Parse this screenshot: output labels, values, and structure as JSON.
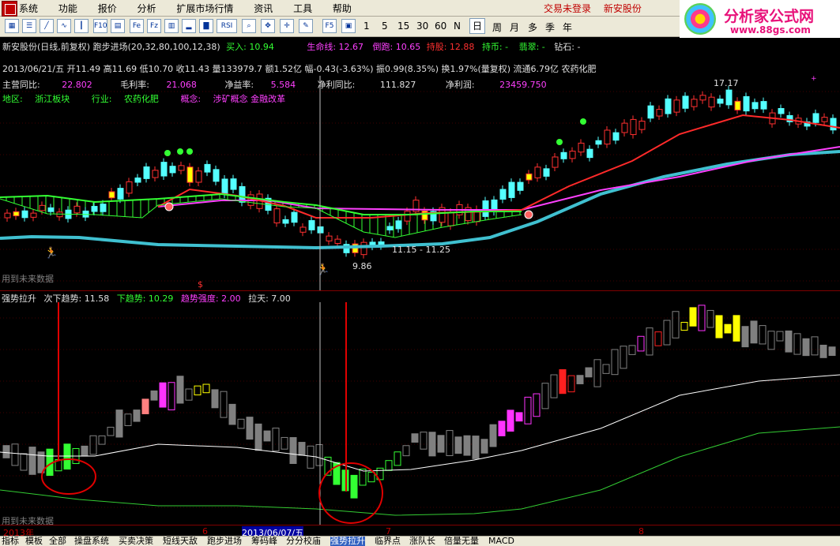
{
  "menu": {
    "items": [
      "系统",
      "功能",
      "报价",
      "分析",
      "扩展市场行情",
      "资讯",
      "工具",
      "帮助"
    ],
    "trade_status": "交易未登录",
    "stock_link": "新安股份"
  },
  "toolbar": {
    "buttons": [
      "Fe",
      "Fz",
      "RSI"
    ],
    "numbers": [
      "1",
      "5",
      "15",
      "30",
      "60",
      "N"
    ],
    "periods": [
      "日",
      "周",
      "月",
      "多",
      "季",
      "年"
    ],
    "active_period": "日"
  },
  "brand": {
    "title": "分析家公式网",
    "url": "www.88gs.com"
  },
  "chart_header": {
    "title": "新安股份(日线,前复权) 跑步进场(20,32,80,100,12,38)",
    "buy_in": "买入: 10.94",
    "lifeline": "生命线: 12.67",
    "escape": "倒跑: 10.65",
    "hold": "持股: 12.88",
    "hold_coin": "持币: -",
    "jade": "翡翠: -",
    "diamond": "钻石: -"
  },
  "quote_line": "2013/06/21/五  开11.49 高11.69 低10.70 收11.43 量133979.7 额1.52亿 幅-0.43(-3.63%) 振0.99(8.35%) 换1.97%(量复权) 流通6.79亿 农药化肥",
  "fundamentals": [
    {
      "label": "主营同比:",
      "value": "22.802"
    },
    {
      "label": "毛利率:",
      "value": "21.068"
    },
    {
      "label": "净益率:",
      "value": "5.584"
    },
    {
      "label": "净利同比:",
      "value": "111.827"
    },
    {
      "label": "净利润:",
      "value": "23459.750"
    }
  ],
  "region": {
    "region_label": "地区:",
    "region": "浙江板块",
    "industry_label": "行业:",
    "industry": "农药化肥",
    "concept_label": "概念:",
    "concepts": "涉矿概念 金融改革"
  },
  "price_annotations": {
    "high": "17.17",
    "low": "9.86",
    "range": "11.15 - 11.25",
    "future_data_note": "用到未来数据",
    "dollar": "$"
  },
  "indicator_header": {
    "name": "强势拉升",
    "up_trend": "次下趋势: 11.58",
    "down_trend": "下趋势: 10.29",
    "strength": "趋势强度: 2.00",
    "pull": "拉天: 7.00"
  },
  "x_axis": {
    "labels": [
      "2013年",
      "6",
      "2013/06/07/五",
      "7",
      "8"
    ]
  },
  "tabs": {
    "items": [
      "指标",
      "模板",
      "全部",
      "操盘系统",
      "买卖决策",
      "短线天敌",
      "跑步进场",
      "筹码峰",
      "分分校庙",
      "强势拉升",
      "临界点",
      "涨队长",
      "倍量无量",
      "MACD"
    ],
    "active": "强势拉升"
  },
  "colors": {
    "up": "#ff3030",
    "down": "#54ffff",
    "green_ma": "#33ff33",
    "red_ma": "#ff2a2a",
    "magenta_ma": "#ff40ff",
    "cyan_ma": "#40c0d0",
    "bg": "#000000",
    "axis": "#800000"
  }
}
